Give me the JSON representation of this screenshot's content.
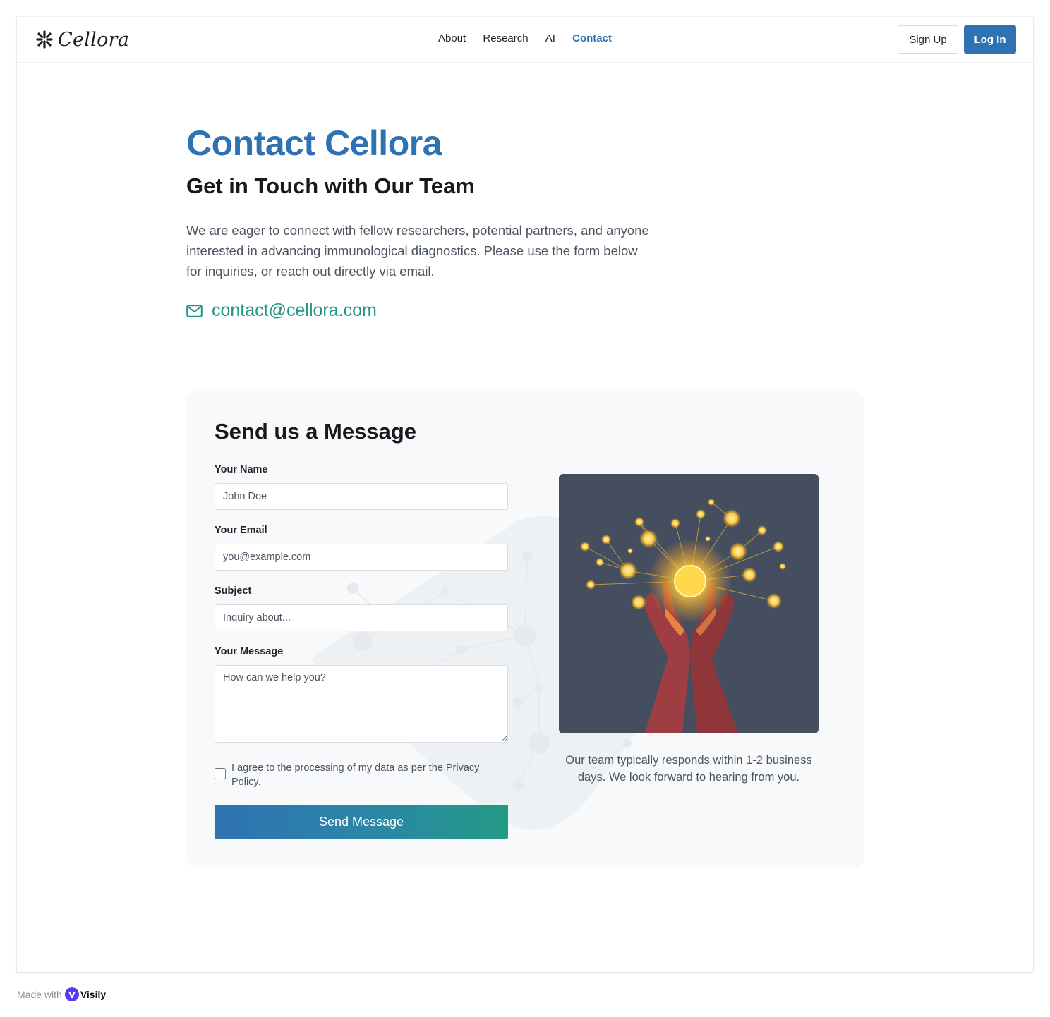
{
  "brand": {
    "name": "Cellora"
  },
  "nav": {
    "items": [
      {
        "label": "About",
        "active": false
      },
      {
        "label": "Research",
        "active": false
      },
      {
        "label": "AI",
        "active": false
      },
      {
        "label": "Contact",
        "active": true
      }
    ],
    "sign_up": "Sign Up",
    "log_in": "Log In"
  },
  "hero": {
    "title": "Contact Cellora",
    "subtitle": "Get in Touch with Our Team",
    "intro": "We are eager to connect with fellow researchers, potential partners, and anyone interested in advancing immunological diagnostics. Please use the form below for inquiries, or reach out directly via email.",
    "email": "contact@cellora.com"
  },
  "form": {
    "title": "Send us a Message",
    "name": {
      "label": "Your Name",
      "placeholder": "John Doe",
      "value": ""
    },
    "email": {
      "label": "Your Email",
      "placeholder": "you@example.com",
      "value": ""
    },
    "subject": {
      "label": "Subject",
      "placeholder": "Inquiry about...",
      "value": ""
    },
    "message": {
      "label": "Your Message",
      "placeholder": "How can we help you?",
      "value": ""
    },
    "consent": {
      "text": "I agree to the processing of my data as per the ",
      "link": "Privacy Policy",
      "suffix": ".",
      "checked": false
    },
    "submit": "Send Message"
  },
  "aside": {
    "caption": "Our team typically responds within 1-2 business days. We look forward to hearing from you."
  },
  "footer": {
    "made_with": "Made with",
    "tool": "Visily"
  },
  "colors": {
    "brand_blue": "#2f72b3",
    "accent_teal": "#239585",
    "text_dark": "#17191c",
    "text_muted": "#4b5360",
    "card_bg": "#f8f9fa",
    "illustration_bg": "#444e5f"
  },
  "icons": {
    "logo": "asterisk-spark-icon",
    "email": "mail-icon"
  }
}
